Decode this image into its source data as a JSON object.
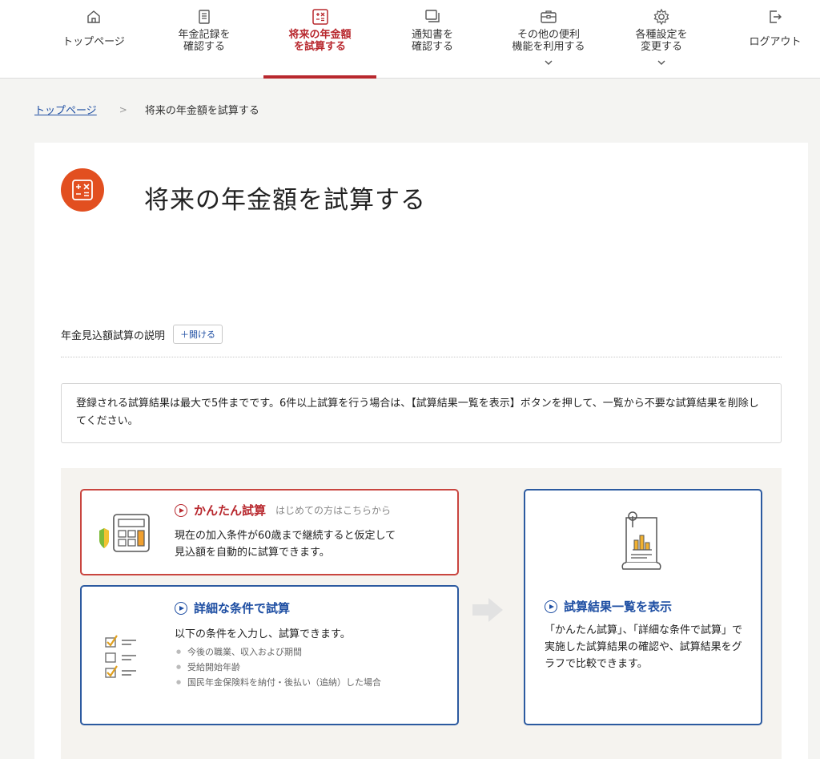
{
  "nav": {
    "items": [
      {
        "label": "トップページ",
        "icon": "home-icon"
      },
      {
        "label": "年金記録を\n確認する",
        "icon": "record-book-icon"
      },
      {
        "label": "将来の年金額\nを試算する",
        "icon": "calculator-icon",
        "active": true
      },
      {
        "label": "通知書を\n確認する",
        "icon": "documents-icon"
      },
      {
        "label": "その他の便利\n機能を利用する",
        "icon": "toolbox-icon",
        "dropdown": true
      },
      {
        "label": "各種設定を\n変更する",
        "icon": "gear-icon",
        "dropdown": true
      },
      {
        "label": "ログアウト",
        "icon": "logout-icon"
      }
    ]
  },
  "breadcrumb": {
    "home": "トップページ",
    "separator": ">",
    "current": "将来の年金額を試算する"
  },
  "page": {
    "title": "将来の年金額を試算する",
    "explain_label": "年金見込額試算の説明",
    "explain_button": "＋開ける",
    "notice": "登録される試算結果は最大で5件までです。6件以上試算を行う場合は、【試算結果一覧を表示】ボタンを押して、一覧から不要な試算結果を削除してください。"
  },
  "cards": {
    "kantan": {
      "title": "かんたん試算",
      "subtitle": "はじめての方はこちらから",
      "desc_line1": "現在の加入条件が60歳まで継続すると仮定して",
      "desc_line2": "見込額を自動的に試算できます。"
    },
    "shosai": {
      "title": "詳細な条件で試算",
      "desc": "以下の条件を入力し、試算できます。",
      "bullets": [
        "今後の職業、収入および期間",
        "受給開始年齢",
        "国民年金保険料を納付・後払い（追納）した場合"
      ]
    },
    "ichiran": {
      "title": "試算結果一覧を表示",
      "desc": "「かんたん試算」、「詳細な条件で試算」で実施した試算結果の確認や、試算結果をグラフで比較できます。"
    }
  },
  "colors": {
    "accent_red": "#b8282e",
    "title_icon_bg": "#e24f20",
    "link_blue": "#1f4fa3",
    "card_blue_border": "#2c5aa0"
  }
}
